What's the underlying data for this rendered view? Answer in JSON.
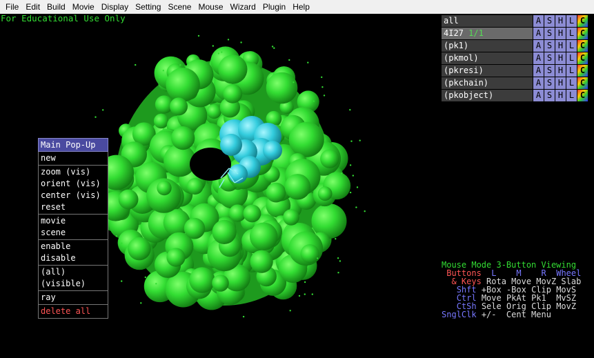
{
  "menubar": {
    "items": [
      "File",
      "Edit",
      "Build",
      "Movie",
      "Display",
      "Setting",
      "Scene",
      "Mouse",
      "Wizard",
      "Plugin",
      "Help"
    ]
  },
  "viewer": {
    "notice": "For Educational Use Only"
  },
  "popup": {
    "title": "Main Pop-Up",
    "groups": [
      [
        "new"
      ],
      [
        "zoom (vis)",
        "orient (vis)",
        "center (vis)",
        "reset"
      ],
      [
        "movie",
        "scene"
      ],
      [
        "enable",
        "disable"
      ],
      [
        "(all)",
        "(visible)"
      ],
      [
        "ray"
      ],
      [
        "delete all"
      ]
    ]
  },
  "objects": {
    "rows": [
      {
        "name": "all",
        "count": ""
      },
      {
        "name": "4I27",
        "count": "1/1"
      },
      {
        "name": "(pk1)",
        "count": ""
      },
      {
        "name": "(pkmol)",
        "count": ""
      },
      {
        "name": "(pkresi)",
        "count": ""
      },
      {
        "name": "(pkchain)",
        "count": ""
      },
      {
        "name": "(pkobject)",
        "count": ""
      }
    ],
    "buttons": [
      "A",
      "S",
      "H",
      "L",
      "C"
    ]
  },
  "mouse": {
    "mode_line": "Mouse Mode 3-Button Viewing",
    "header": [
      "Buttons",
      "L",
      "M",
      "R",
      "Wheel"
    ],
    "rows": [
      {
        "mod": "& Keys",
        "vals": "Rota Move MovZ Slab"
      },
      {
        "mod": "Shft",
        "vals": "+Box -Box Clip MovS"
      },
      {
        "mod": "Ctrl",
        "vals": "Move PkAt Pk1  MvSZ"
      },
      {
        "mod": "CtSh",
        "vals": "Sele Orig Clip MovZ"
      },
      {
        "mod": "SnglClk",
        "vals": "+/-  Cent Menu"
      }
    ]
  },
  "colors": {
    "surface": "#33dd33",
    "ligand_surface": "#33ccdd",
    "notice": "#33dd33",
    "popup_title_bg": "#4a4aa0"
  }
}
